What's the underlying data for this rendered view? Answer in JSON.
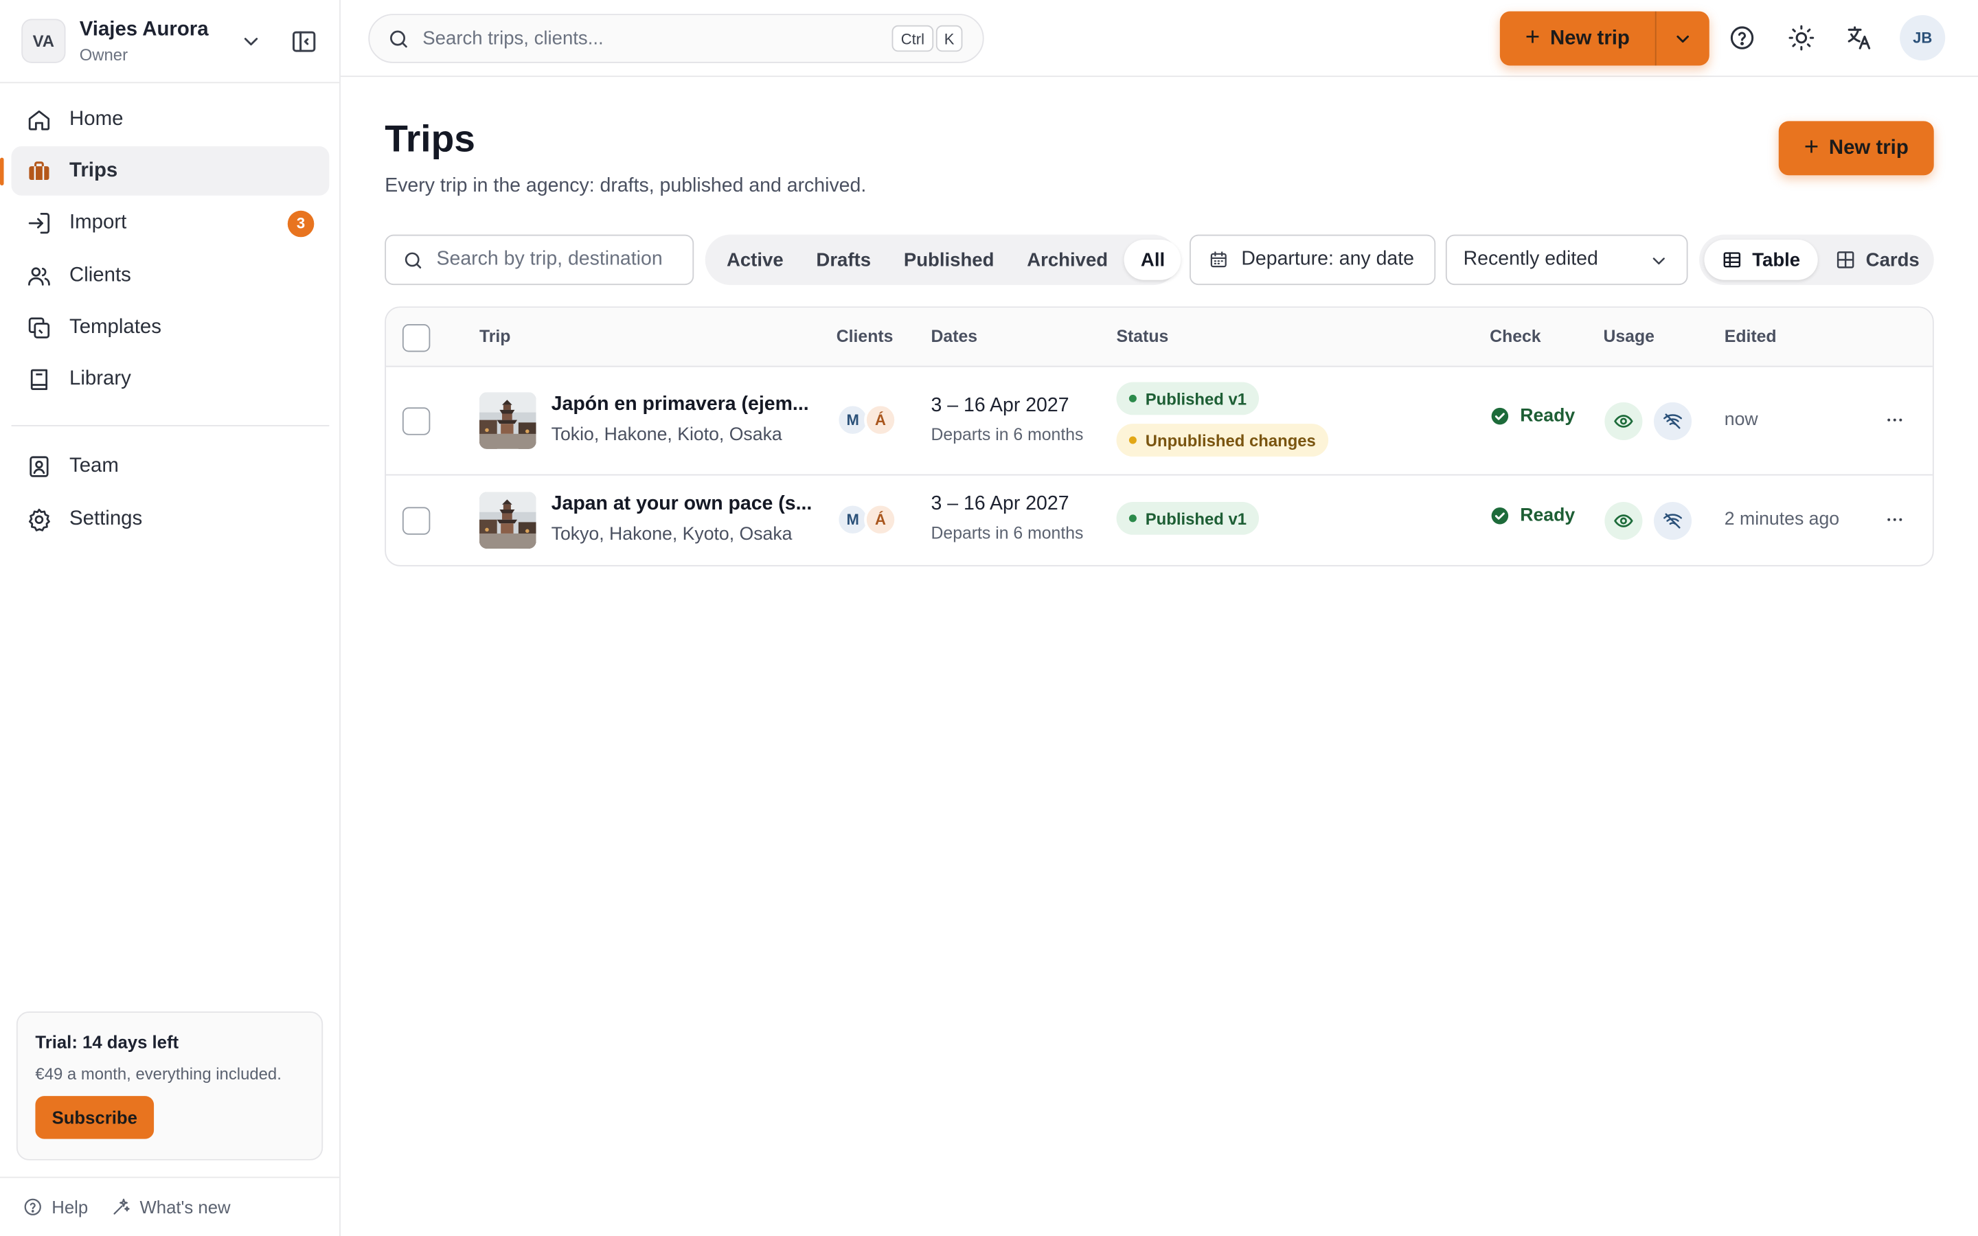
{
  "org": {
    "initials": "VA",
    "name": "Viajes Aurora",
    "role": "Owner"
  },
  "nav": {
    "items": [
      {
        "label": "Home",
        "icon": "home-icon"
      },
      {
        "label": "Trips",
        "icon": "suitcase-icon",
        "active": true
      },
      {
        "label": "Import",
        "icon": "import-icon",
        "badge": "3"
      },
      {
        "label": "Clients",
        "icon": "users-icon"
      },
      {
        "label": "Templates",
        "icon": "templates-icon"
      },
      {
        "label": "Library",
        "icon": "book-icon"
      }
    ],
    "secondary": [
      {
        "label": "Team",
        "icon": "team-icon"
      },
      {
        "label": "Settings",
        "icon": "gear-icon"
      }
    ]
  },
  "trial": {
    "title": "Trial: 14 days left",
    "subtitle": "€49 a month, everything included.",
    "button": "Subscribe"
  },
  "footer": {
    "help": "Help",
    "whats_new": "What's new"
  },
  "topbar": {
    "search_placeholder": "Search trips, clients...",
    "kbd_ctrl": "Ctrl",
    "kbd_k": "K",
    "new_trip": "New trip",
    "user_initials": "JB"
  },
  "page": {
    "title": "Trips",
    "subtitle": "Every trip in the agency: drafts, published and archived.",
    "new_trip": "New trip"
  },
  "filters": {
    "search_placeholder": "Search by trip, destination",
    "tabs": [
      "Active",
      "Drafts",
      "Published",
      "Archived",
      "All"
    ],
    "selected_tab": "All",
    "departure": "Departure: any date",
    "sort": "Recently edited",
    "views": [
      "Table",
      "Cards"
    ],
    "selected_view": "Table"
  },
  "table": {
    "columns": [
      "Trip",
      "Clients",
      "Dates",
      "Status",
      "Check",
      "Usage",
      "Edited"
    ],
    "rows": [
      {
        "name": "Japón en primavera (ejem...",
        "destinations": "Tokio, Hakone, Kioto, Osaka",
        "clients": [
          "M",
          "Á"
        ],
        "dates": "3 – 16 Apr 2027",
        "departs": "Departs in 6 months",
        "status": [
          "Published v1",
          "Unpublished changes"
        ],
        "check": "Ready",
        "edited": "now"
      },
      {
        "name": "Japan at your own pace (s...",
        "destinations": "Tokyo, Hakone, Kyoto, Osaka",
        "clients": [
          "M",
          "Á"
        ],
        "dates": "3 – 16 Apr 2027",
        "departs": "Departs in 6 months",
        "status": [
          "Published v1"
        ],
        "check": "Ready",
        "edited": "2 minutes ago"
      }
    ]
  },
  "colors": {
    "accent": "#e8741f",
    "success": "#1d5e34",
    "warning": "#e2a716"
  }
}
